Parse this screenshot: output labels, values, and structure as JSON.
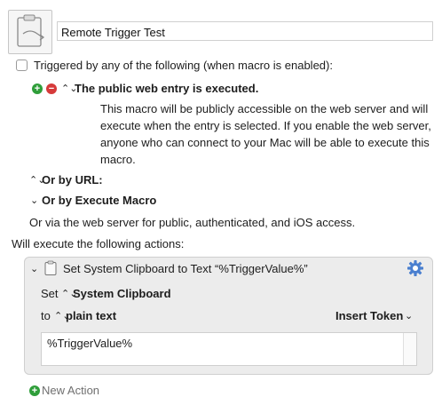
{
  "macro": {
    "name": "Remote Trigger Test"
  },
  "triggers": {
    "master_label": "Triggered by any of the following (when macro is enabled):",
    "web_entry": {
      "title": "The public web entry is executed.",
      "description": "This macro will be publicly accessible on the web server and will execute when the entry is selected.  If you enable the web server, anyone who can connect to your Mac will be able to execute this macro."
    },
    "or_by_url": "Or by URL:",
    "or_by_execute_macro": "Or by Execute Macro",
    "web_server_note": "Or via the web server for public, authenticated, and iOS access."
  },
  "actions": {
    "header": "Will execute the following actions:",
    "items": [
      {
        "title": "Set System Clipboard to Text “%TriggerValue%”",
        "set_label": "Set",
        "target": "System Clipboard",
        "to_label": "to",
        "format": "plain text",
        "insert_token": "Insert Token",
        "text_value": "%TriggerValue%"
      }
    ],
    "new_action": "New Action"
  },
  "colors": {
    "add": "#2f9e3a",
    "remove": "#d63a3a",
    "gear": "#4a7fcf"
  }
}
